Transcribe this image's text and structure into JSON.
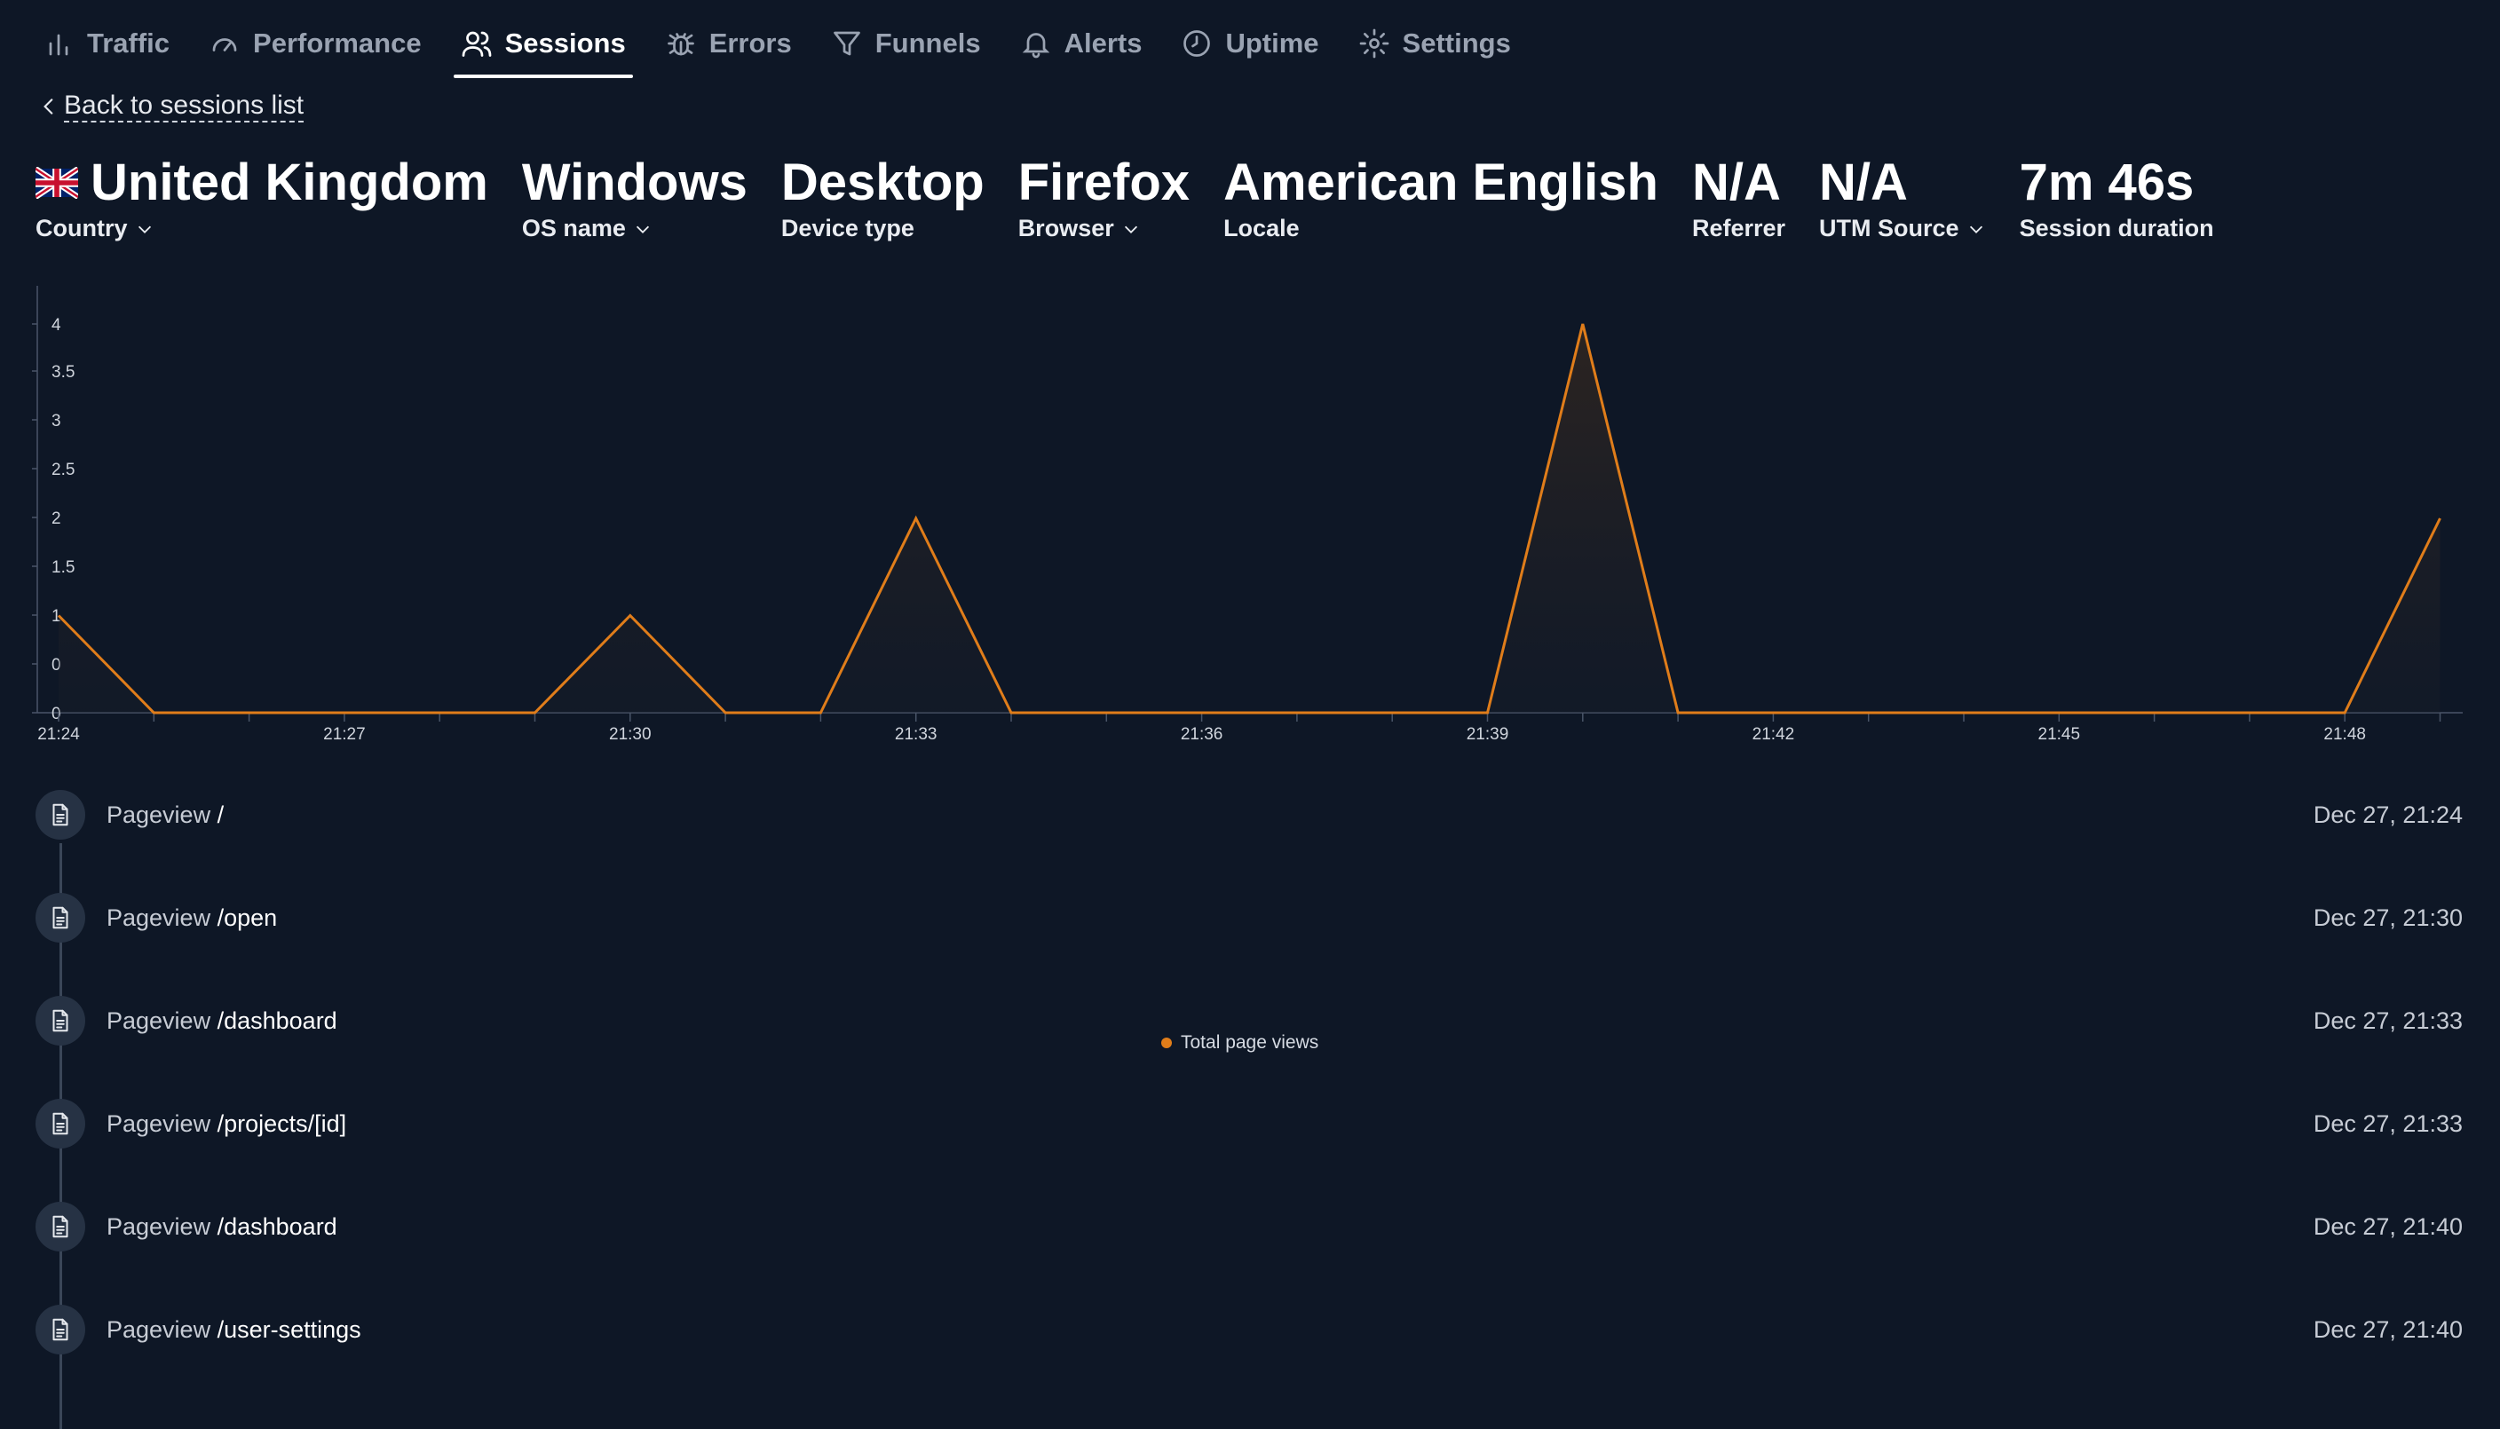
{
  "nav": {
    "items": [
      {
        "label": "Traffic",
        "icon": "bar-chart-icon",
        "active": false
      },
      {
        "label": "Performance",
        "icon": "gauge-icon",
        "active": false
      },
      {
        "label": "Sessions",
        "icon": "users-icon",
        "active": true
      },
      {
        "label": "Errors",
        "icon": "bug-icon",
        "active": false
      },
      {
        "label": "Funnels",
        "icon": "funnel-icon",
        "active": false
      },
      {
        "label": "Alerts",
        "icon": "bell-icon",
        "active": false
      },
      {
        "label": "Uptime",
        "icon": "clock-icon",
        "active": false
      },
      {
        "label": "Settings",
        "icon": "gear-icon",
        "active": false
      }
    ]
  },
  "back": {
    "label": "Back to sessions list"
  },
  "stats": {
    "country": {
      "value": "United Kingdom",
      "label": "Country",
      "flag": "uk-flag-icon"
    },
    "os": {
      "value": "Windows",
      "label": "OS name"
    },
    "device": {
      "value": "Desktop",
      "label": "Device type"
    },
    "browser": {
      "value": "Firefox",
      "label": "Browser"
    },
    "locale": {
      "value": "American English",
      "label": "Locale"
    },
    "referrer": {
      "value": "N/A",
      "label": "Referrer"
    },
    "utm": {
      "value": "N/A",
      "label": "UTM Source"
    },
    "duration": {
      "value": "7m 46s",
      "label": "Session duration"
    }
  },
  "chart_data": {
    "type": "area",
    "series": [
      {
        "name": "Total page views",
        "color": "#e07d1a",
        "x": [
          "21:24",
          "21:25",
          "21:26",
          "21:27",
          "21:28",
          "21:29",
          "21:30",
          "21:31",
          "21:32",
          "21:33",
          "21:34",
          "21:35",
          "21:36",
          "21:37",
          "21:38",
          "21:39",
          "21:40",
          "21:41",
          "21:42",
          "21:43",
          "21:44",
          "21:45",
          "21:46",
          "21:47",
          "21:48",
          "21:49"
        ],
        "values": [
          1,
          0,
          0,
          0,
          0,
          0,
          1,
          0,
          0,
          2,
          0,
          0,
          0,
          0,
          0,
          0,
          4,
          0,
          0,
          0,
          0,
          0,
          0,
          0,
          0,
          2
        ]
      }
    ],
    "x_tick_labels": [
      "21:24",
      "21:27",
      "21:30",
      "21:33",
      "21:36",
      "21:39",
      "21:42",
      "21:45",
      "21:48"
    ],
    "y_tick_labels": [
      "0",
      "0",
      "1",
      "1.5",
      "2",
      "2.5",
      "3",
      "3.5",
      "4"
    ],
    "ylim": [
      0,
      4
    ],
    "legend": "bottom-center",
    "grid": false
  },
  "timeline": [
    {
      "type": "Pageview",
      "path": "/",
      "time": "Dec 27, 21:24"
    },
    {
      "type": "Pageview",
      "path": "/open",
      "time": "Dec 27, 21:30"
    },
    {
      "type": "Pageview",
      "path": "/dashboard",
      "time": "Dec 27, 21:33"
    },
    {
      "type": "Pageview",
      "path": "/projects/[id]",
      "time": "Dec 27, 21:33"
    },
    {
      "type": "Pageview",
      "path": "/dashboard",
      "time": "Dec 27, 21:40"
    },
    {
      "type": "Pageview",
      "path": "/user-settings",
      "time": "Dec 27, 21:40"
    }
  ]
}
